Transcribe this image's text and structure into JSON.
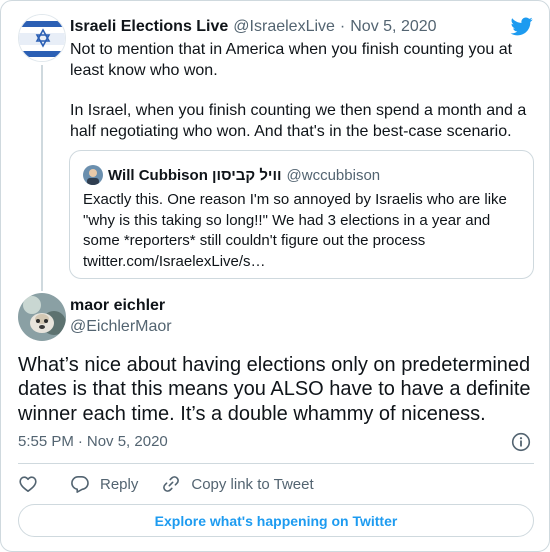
{
  "parent": {
    "name": "Israeli Elections Live",
    "handle": "@IsraelexLive",
    "separator": "·",
    "date": "Nov 5, 2020",
    "paragraphs": [
      "Not to mention that in America when you finish counting you at least know who won.",
      "In Israel, when you finish counting we then spend a month and a half negotiating who won. And that's in the best-case scenario."
    ]
  },
  "quote": {
    "name": "Will Cubbison וויל קביסון",
    "handle": "@wccubbison",
    "text": "Exactly this. One reason I'm so annoyed by Israelis who are like \"why is this taking so long!!\" We had 3 elections in a year and some *reporters* still couldn't figure out the process",
    "link": "twitter.com/IsraelexLive/s…"
  },
  "tweet": {
    "name": "maor eichler",
    "handle": "@EichlerMaor",
    "text": "What’s nice about having elections only on predetermined dates is that this means you ALSO have to have a definite winner each time. It’s a double whammy of niceness.",
    "time": "5:55 PM",
    "separator": "·",
    "date": "Nov 5, 2020"
  },
  "actions": {
    "reply": "Reply",
    "copy_link": "Copy link to Tweet"
  },
  "explore_label": "Explore what's happening on Twitter",
  "icons": {
    "brand": "twitter-bird-icon",
    "info": "info-icon",
    "like": "heart-icon",
    "reply": "reply-bubble-icon",
    "copy": "link-icon"
  },
  "colors": {
    "accent": "#1d9bf0",
    "text": "#0f1419",
    "muted": "#536471",
    "border": "#cfd9de"
  }
}
